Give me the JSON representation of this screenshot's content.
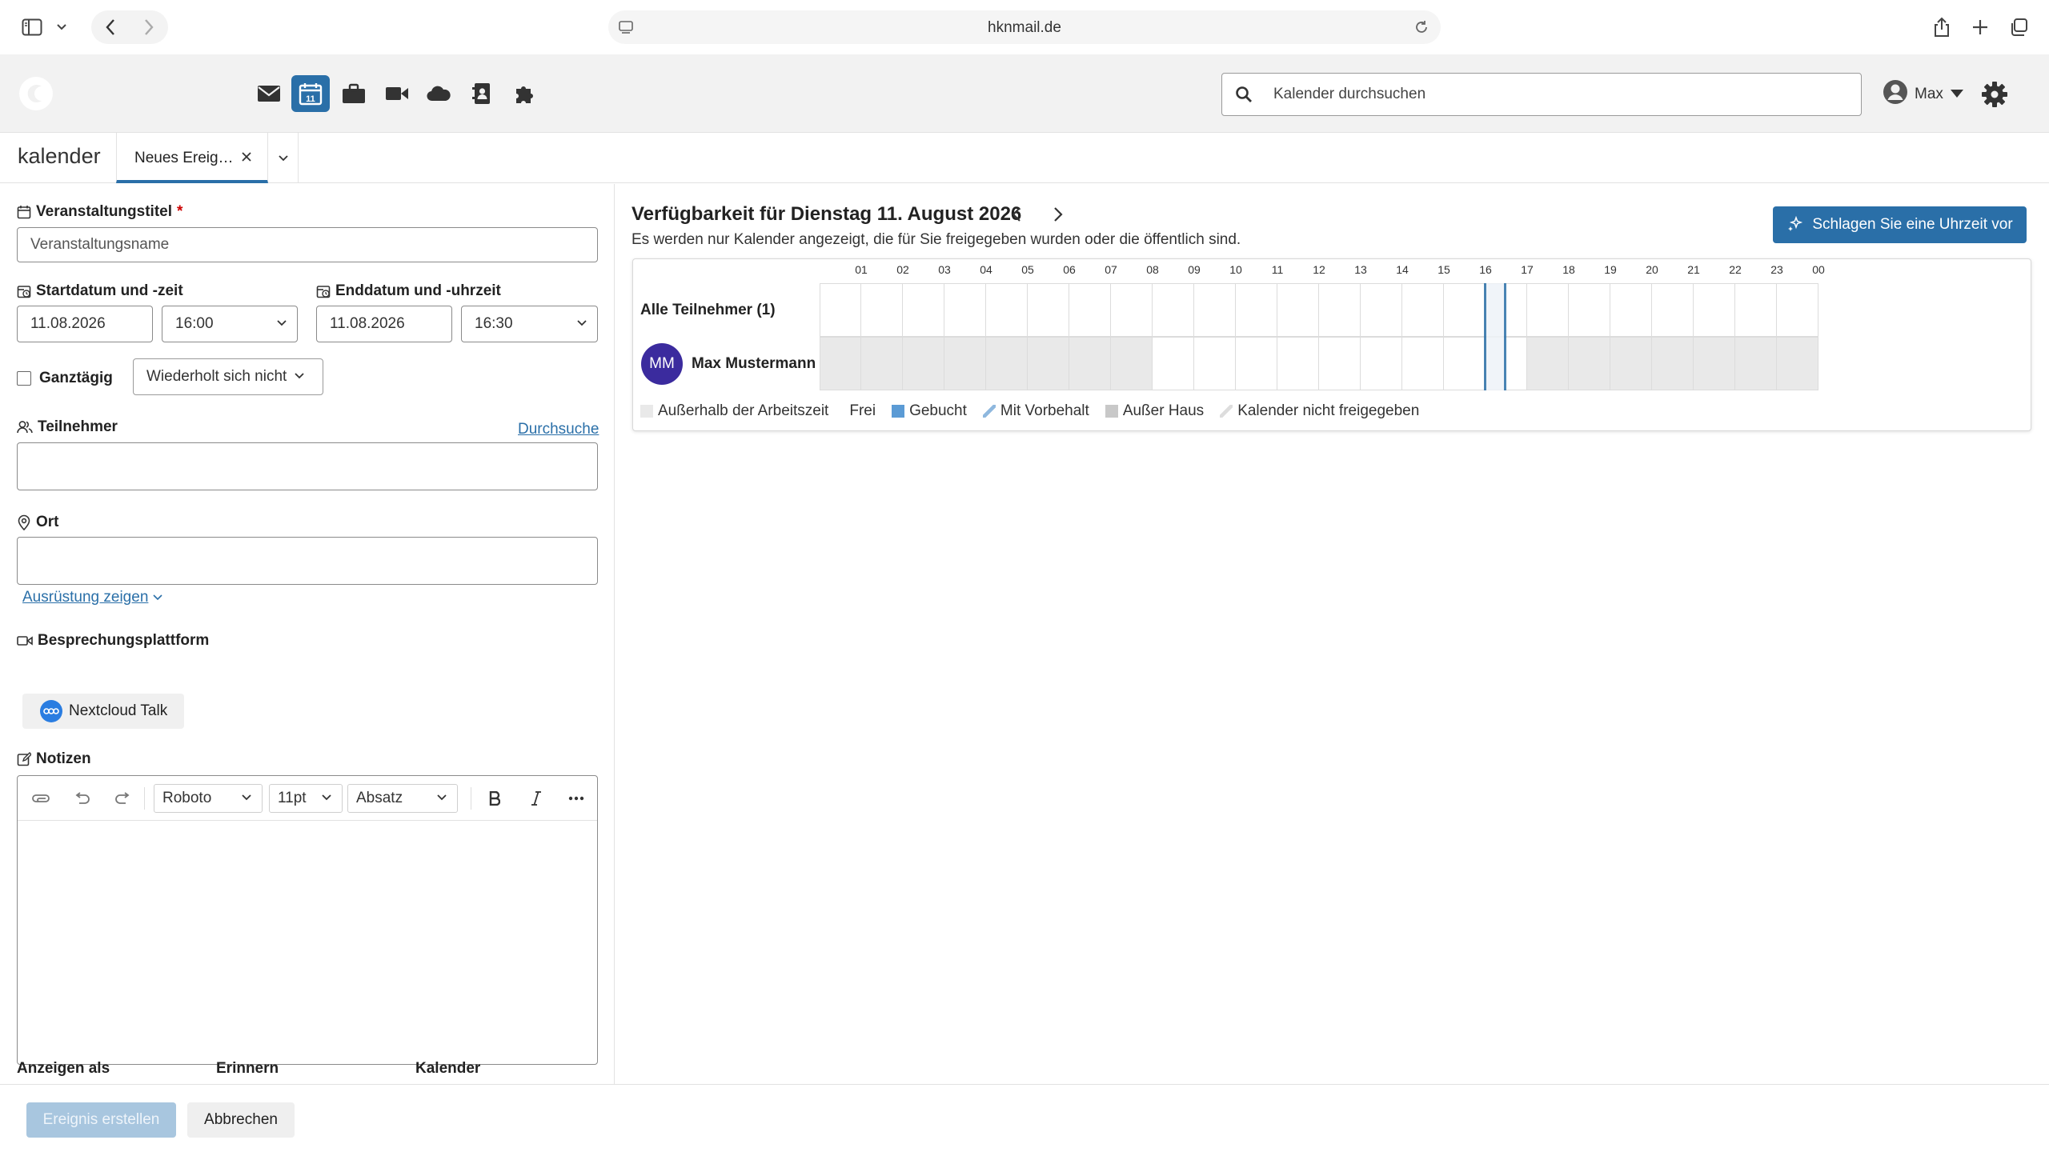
{
  "browser": {
    "url": "hknmail.de"
  },
  "app": {
    "nav_icons": [
      "mail-icon",
      "calendar-icon",
      "briefcase-icon",
      "video-icon",
      "cloud-icon",
      "contacts-icon",
      "puzzle-icon"
    ],
    "calendar_icon_day": "11",
    "active_app": "calendar",
    "search_placeholder": "Kalender durchsuchen",
    "user_name": "Max",
    "accent_color": "#2a6fa8"
  },
  "tabs": {
    "app_title": "kalender",
    "active_tab_label": "Neues Ereig…"
  },
  "form": {
    "title_label": "Veranstaltungstitel",
    "required_marker": "*",
    "title_placeholder": "Veranstaltungsname",
    "start_label": "Startdatum und -zeit",
    "start_date": "11.08.2026",
    "start_time": "16:00",
    "end_label": "Enddatum und -uhrzeit",
    "end_date": "11.08.2026",
    "end_time": "16:30",
    "allday_label": "Ganztägig",
    "allday_checked": false,
    "repeat_value": "Wiederholt sich nicht",
    "participants_label": "Teilnehmer",
    "browse_link": "Durchsuche",
    "location_label": "Ort",
    "equipment_link": "Ausrüstung zeigen",
    "meeting_platform_label": "Besprechungsplattform",
    "talk_button": "Nextcloud Talk",
    "notes_label": "Notizen",
    "editor": {
      "font": "Roboto",
      "size": "11pt",
      "block": "Absatz"
    },
    "show_as_label": "Anzeigen als",
    "remind_label": "Erinnern",
    "calendar_label": "Kalender"
  },
  "actions": {
    "create": "Ereignis erstellen",
    "cancel": "Abbrechen"
  },
  "availability": {
    "title": "Verfügbarkeit für Dienstag 11. August 2026",
    "subtitle": "Es werden nur Kalender angezeigt, die für Sie freigegeben wurden oder die öffentlich sind.",
    "suggest_button": "Schlagen Sie eine Uhrzeit vor",
    "hours": [
      "01",
      "02",
      "03",
      "04",
      "05",
      "06",
      "07",
      "08",
      "09",
      "10",
      "11",
      "12",
      "13",
      "14",
      "15",
      "16",
      "17",
      "18",
      "19",
      "20",
      "21",
      "22",
      "23",
      "00"
    ],
    "all_participants_label": "Alle Teilnehmer (1)",
    "participant_initials": "MM",
    "participant_name": "Max Mustermann",
    "participant_avatar_color": "#3b2b9e",
    "working_hours": {
      "start": "08:00",
      "end": "17:00"
    },
    "selected_slot": {
      "start": "16:00",
      "end": "16:30"
    },
    "legend": [
      {
        "label": "Außerhalb der Arbeitszeit",
        "color": "#e9e9e9"
      },
      {
        "label": "Frei",
        "color": "#ffffff"
      },
      {
        "label": "Gebucht",
        "color": "#5b9bd5"
      },
      {
        "label": "Mit Vorbehalt",
        "color": "#8fb8de"
      },
      {
        "label": "Außer Haus",
        "color": "#c8c8c8"
      },
      {
        "label": "Kalender nicht freigegeben",
        "color": "#dddddd"
      }
    ]
  }
}
